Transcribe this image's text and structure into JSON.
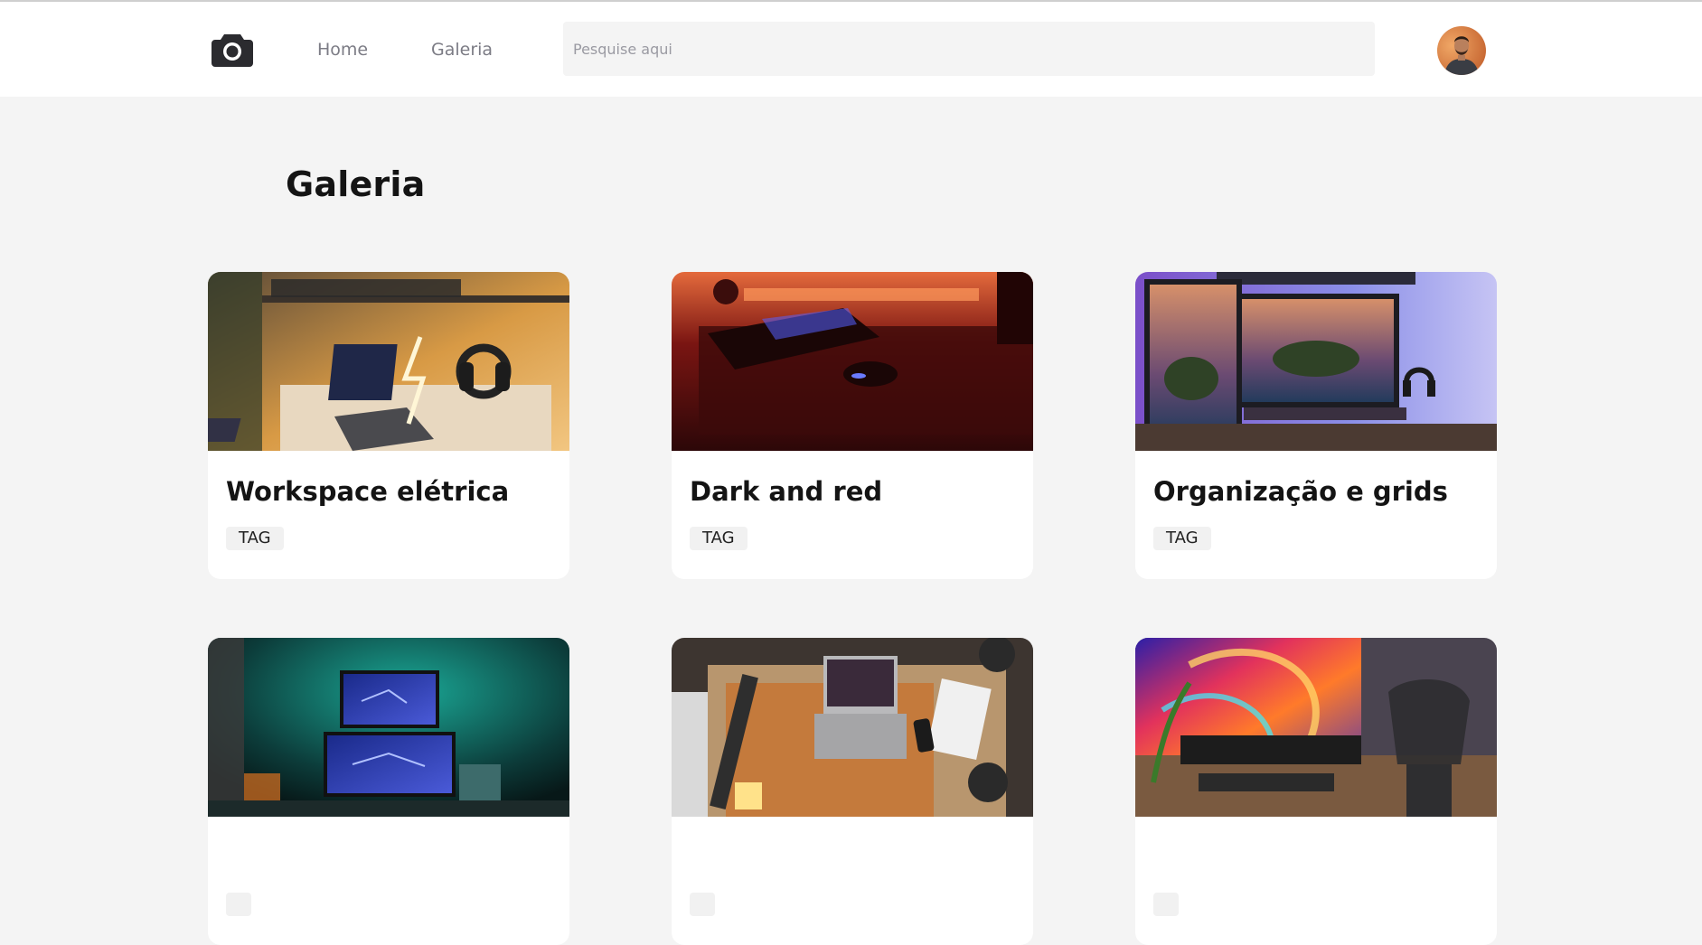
{
  "header": {
    "nav": {
      "home": "Home",
      "gallery": "Galeria"
    },
    "search": {
      "placeholder": "Pesquise aqui",
      "value": ""
    }
  },
  "page": {
    "title": "Galeria"
  },
  "cards": [
    {
      "title": "Workspace elétrica",
      "tag": "TAG"
    },
    {
      "title": "Dark and red",
      "tag": "TAG"
    },
    {
      "title": "Organização e grids",
      "tag": "TAG"
    },
    {
      "title": "",
      "tag": ""
    },
    {
      "title": "",
      "tag": ""
    },
    {
      "title": "",
      "tag": ""
    }
  ],
  "colors": {
    "background": "#f4f4f4",
    "header": "#ffffff",
    "nav_text": "#7c7c85",
    "title_text": "#141414",
    "tag_bg": "#f1f1f1"
  }
}
